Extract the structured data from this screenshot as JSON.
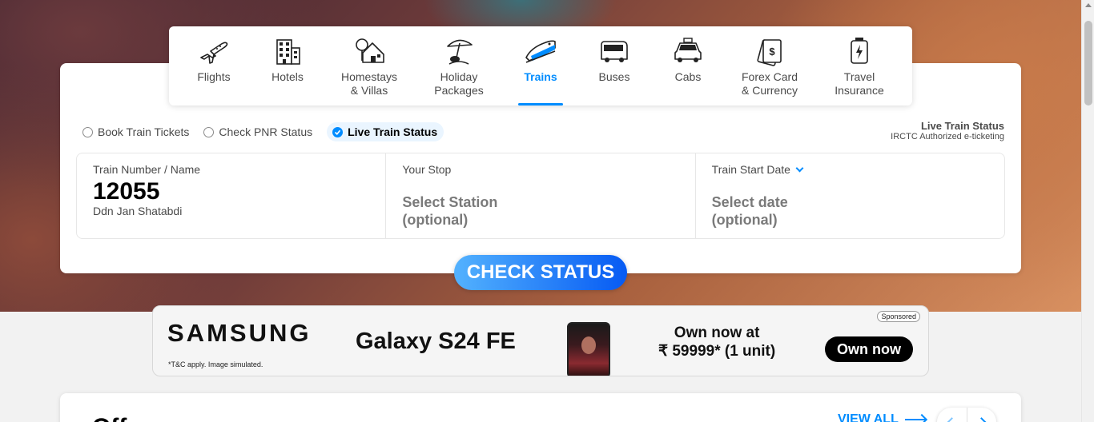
{
  "nav": {
    "items": [
      {
        "label": "Flights",
        "icon": "flight-icon"
      },
      {
        "label": "Hotels",
        "icon": "hotel-icon"
      },
      {
        "label": "Homestays\n& Villas",
        "icon": "homestay-icon"
      },
      {
        "label": "Holiday\nPackages",
        "icon": "holiday-icon"
      },
      {
        "label": "Trains",
        "icon": "train-icon",
        "active": true
      },
      {
        "label": "Buses",
        "icon": "bus-icon"
      },
      {
        "label": "Cabs",
        "icon": "cab-icon"
      },
      {
        "label": "Forex Card\n& Currency",
        "icon": "forex-icon"
      },
      {
        "label": "Travel\nInsurance",
        "icon": "insurance-icon"
      }
    ]
  },
  "radios": {
    "book": "Book Train Tickets",
    "pnr": "Check PNR Status",
    "live": "Live Train Status"
  },
  "irctc": {
    "title": "Live Train Status",
    "subtitle": "IRCTC Authorized e-ticketing"
  },
  "fields": {
    "train": {
      "label": "Train Number / Name",
      "value": "12055",
      "sub": "Ddn Jan Shatabdi"
    },
    "stop": {
      "label": "Your Stop",
      "placeholder": "Select Station\n(optional)"
    },
    "date": {
      "label": "Train Start Date",
      "placeholder": "Select date\n(optional)"
    }
  },
  "cta": {
    "label": "CHECK STATUS"
  },
  "ad": {
    "brand": "SAMSUNG",
    "terms": "*T&C apply. Image simulated.",
    "product": "Galaxy S24 FE",
    "offer_line1": "Own now at",
    "offer_line2": "₹ 59999* (1 unit)",
    "cta": "Own now",
    "sponsored": "Sponsored"
  },
  "offers": {
    "title": "Offers",
    "view_all": "VIEW ALL"
  },
  "colors": {
    "accent": "#008cff",
    "cta_start": "#53b2fe",
    "cta_end": "#065af3"
  }
}
